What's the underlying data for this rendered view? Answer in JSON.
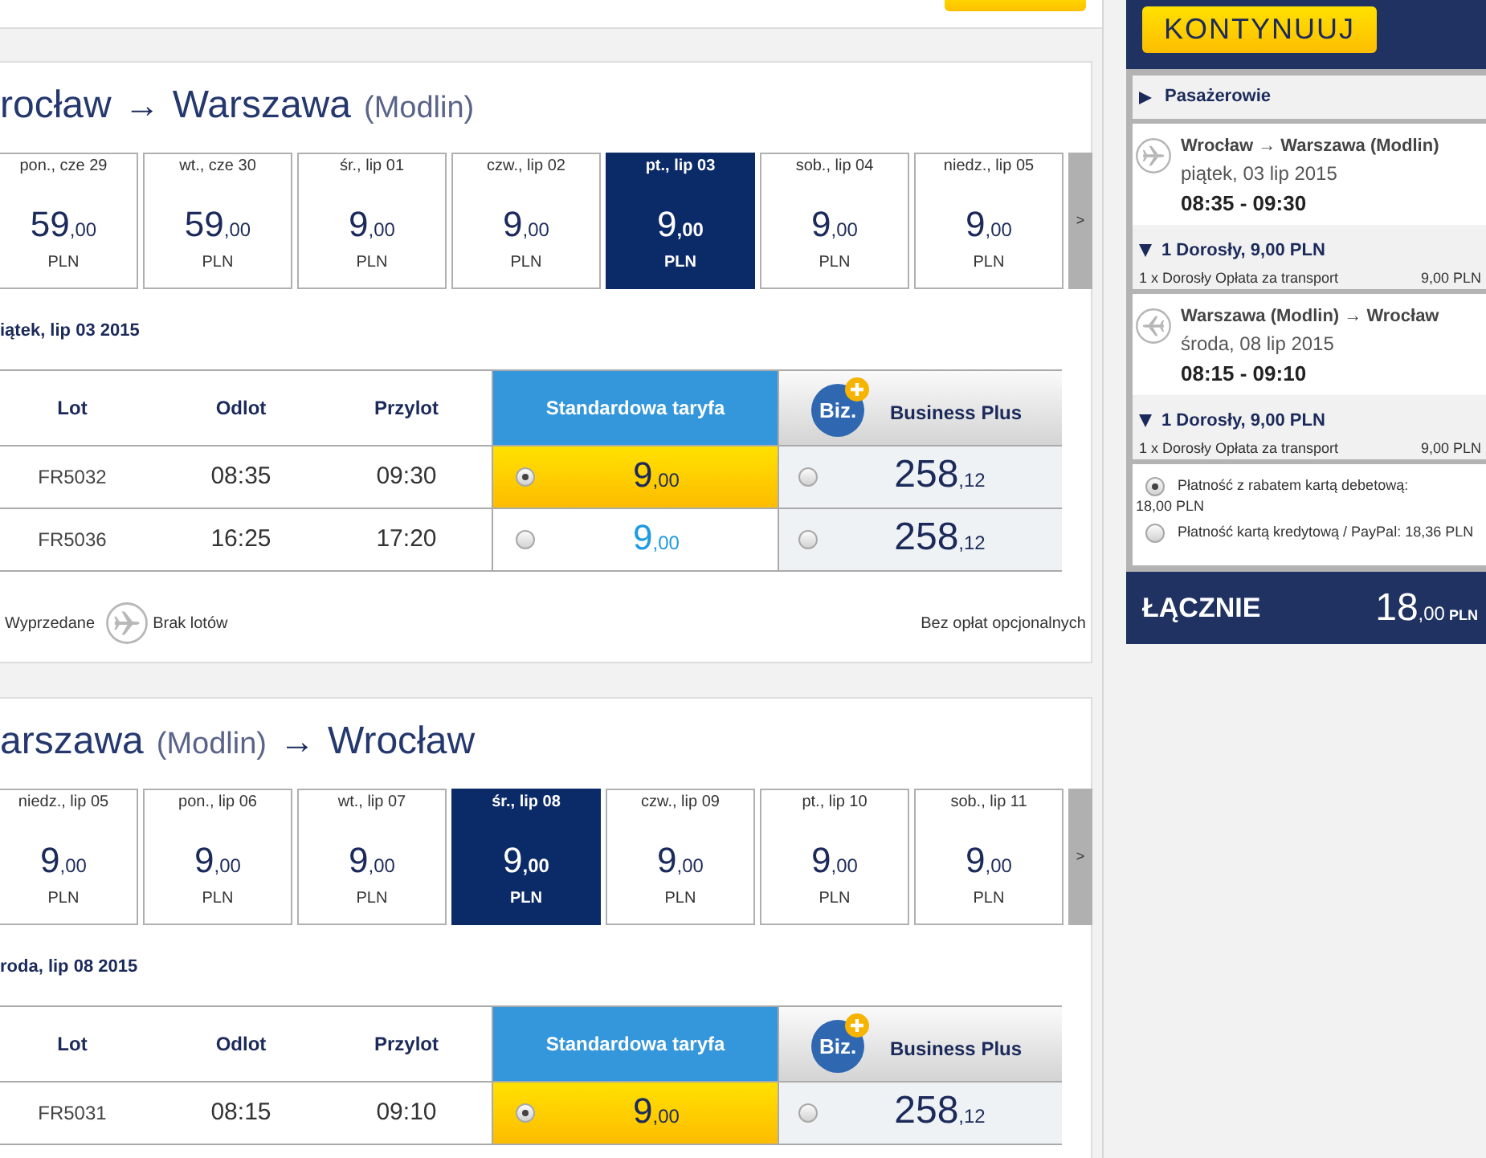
{
  "sections": [
    {
      "route": [
        {
          "kind": "city",
          "text": "rocław"
        },
        {
          "kind": "arrow",
          "text": "→"
        },
        {
          "kind": "city",
          "text": "Warszawa"
        },
        {
          "kind": "airport",
          "text": "(Modlin)"
        }
      ],
      "dates": [
        {
          "day": "pon., cze 29",
          "price": "59",
          "decimals": ",00",
          "currency": "PLN",
          "selected": false
        },
        {
          "day": "wt., cze 30",
          "price": "59",
          "decimals": ",00",
          "currency": "PLN",
          "selected": false
        },
        {
          "day": "śr., lip 01",
          "price": "9",
          "decimals": ",00",
          "currency": "PLN",
          "selected": false
        },
        {
          "day": "czw., lip 02",
          "price": "9",
          "decimals": ",00",
          "currency": "PLN",
          "selected": false
        },
        {
          "day": "pt., lip 03",
          "price": "9",
          "decimals": ",00",
          "currency": "PLN",
          "selected": true
        },
        {
          "day": "sob., lip 04",
          "price": "9",
          "decimals": ",00",
          "currency": "PLN",
          "selected": false
        },
        {
          "day": "niedz., lip 05",
          "price": "9",
          "decimals": ",00",
          "currency": "PLN",
          "selected": false
        }
      ],
      "next": ">",
      "date_heading": "iątek, lip 03 2015",
      "columns": {
        "flight": "Lot",
        "departure": "Odlot",
        "arrival": "Przylot",
        "standard": "Standardowa taryfa",
        "business_logo": "Biz.",
        "business": "Business Plus"
      },
      "flights": [
        {
          "number": "FR5032",
          "departure": "08:35",
          "arrival": "09:30",
          "standard": {
            "price": "9",
            "decimals": ",00",
            "selected": true
          },
          "business": {
            "price": "258",
            "decimals": ",12",
            "selected": false
          }
        },
        {
          "number": "FR5036",
          "departure": "16:25",
          "arrival": "17:20",
          "standard": {
            "price": "9",
            "decimals": ",00",
            "selected": false
          },
          "business": {
            "price": "258",
            "decimals": ",12",
            "selected": false
          }
        }
      ],
      "legend": [
        {
          "kind": "sold_out",
          "label": "Wyprzedane"
        },
        {
          "kind": "no_flights",
          "label": "Brak lotów"
        }
      ],
      "note": "Bez opłat opcjonalnych"
    },
    {
      "route": [
        {
          "kind": "city",
          "text": "arszawa"
        },
        {
          "kind": "airport",
          "text": "(Modlin)"
        },
        {
          "kind": "arrow",
          "text": "→"
        },
        {
          "kind": "city",
          "text": "Wrocław"
        }
      ],
      "dates": [
        {
          "day": "niedz., lip 05",
          "price": "9",
          "decimals": ",00",
          "currency": "PLN",
          "selected": false
        },
        {
          "day": "pon., lip 06",
          "price": "9",
          "decimals": ",00",
          "currency": "PLN",
          "selected": false
        },
        {
          "day": "wt., lip 07",
          "price": "9",
          "decimals": ",00",
          "currency": "PLN",
          "selected": false
        },
        {
          "day": "śr., lip 08",
          "price": "9",
          "decimals": ",00",
          "currency": "PLN",
          "selected": true
        },
        {
          "day": "czw., lip 09",
          "price": "9",
          "decimals": ",00",
          "currency": "PLN",
          "selected": false
        },
        {
          "day": "pt., lip 10",
          "price": "9",
          "decimals": ",00",
          "currency": "PLN",
          "selected": false
        },
        {
          "day": "sob., lip 11",
          "price": "9",
          "decimals": ",00",
          "currency": "PLN",
          "selected": false
        }
      ],
      "next": ">",
      "date_heading": "roda, lip 08 2015",
      "columns": {
        "flight": "Lot",
        "departure": "Odlot",
        "arrival": "Przylot",
        "standard": "Standardowa taryfa",
        "business_logo": "Biz.",
        "business": "Business Plus"
      },
      "flights": [
        {
          "number": "FR5031",
          "departure": "08:15",
          "arrival": "09:10",
          "standard": {
            "price": "9",
            "decimals": ",00",
            "selected": true
          },
          "business": {
            "price": "258",
            "decimals": ",12",
            "selected": false
          }
        }
      ]
    }
  ],
  "sidebar": {
    "continue_button": "KONTYNUUJ",
    "passengers": {
      "label": "Pasażerowie",
      "expanded": false
    },
    "trips": [
      {
        "kind": "outbound",
        "route": "Wrocław → Warszawa (Modlin)",
        "date": "piątek, 03 lip 2015",
        "time": "08:35 - 09:30",
        "fare": {
          "summary": "1 Dorosły, 9,00 PLN",
          "expanded": true,
          "items": [
            {
              "label": "1 x Dorosły Opłata za transport",
              "amount": "9,00 PLN"
            }
          ]
        }
      },
      {
        "kind": "return",
        "route": "Warszawa (Modlin) → Wrocław",
        "date": "środa, 08 lip 2015",
        "time": "08:15 - 09:10",
        "fare": {
          "summary": "1 Dorosły, 9,00 PLN",
          "expanded": true,
          "items": [
            {
              "label": "1 x Dorosły Opłata za transport",
              "amount": "9,00 PLN"
            }
          ]
        }
      }
    ],
    "payment_options": [
      {
        "label": "Płatność z rabatem kartą debetową:",
        "amount": "18,00 PLN",
        "selected": true
      },
      {
        "label": "Płatność kartą kredytową / PayPal:",
        "amount": "18,36 PLN",
        "selected": false
      }
    ],
    "total": {
      "label": "ŁĄCZNIE",
      "amount": "18",
      "decimals": ",00",
      "currency": "PLN"
    }
  }
}
